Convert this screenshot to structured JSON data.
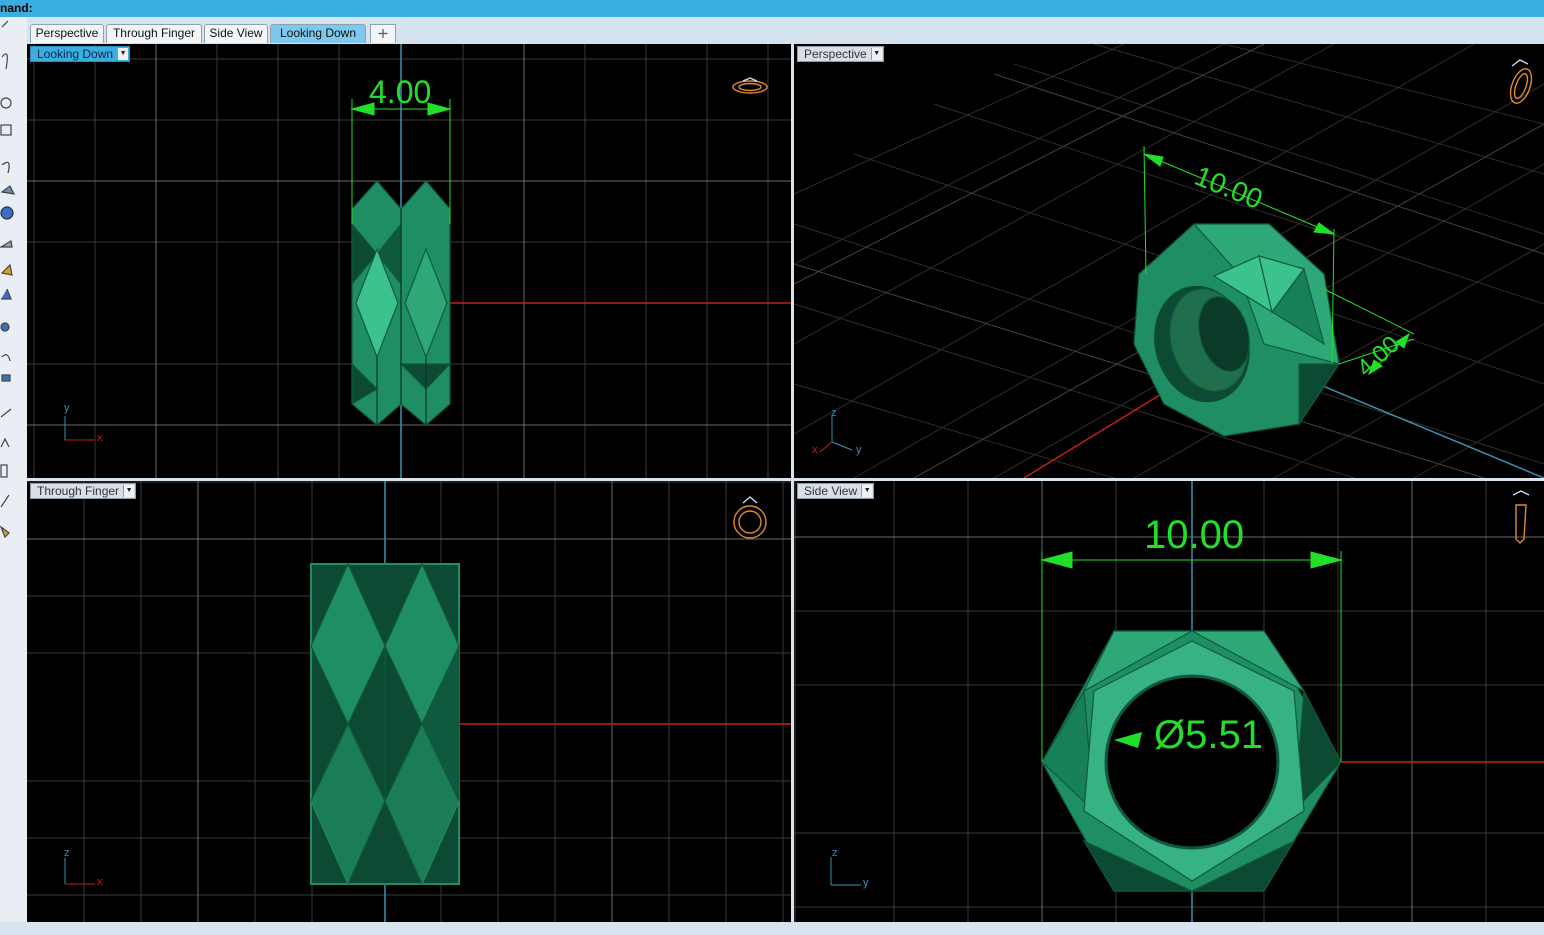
{
  "command": {
    "label": "nand:"
  },
  "tabs": [
    {
      "label": "Perspective",
      "active": false
    },
    {
      "label": "Through Finger",
      "active": false
    },
    {
      "label": "Side View",
      "active": false
    },
    {
      "label": "Looking Down",
      "active": true
    }
  ],
  "add_tab_icon": "plus-icon",
  "viewports": {
    "top_left": {
      "label": "Looking Down",
      "active": true,
      "dimension": "4.00",
      "axis_a": "y",
      "axis_b": "x"
    },
    "top_right": {
      "label": "Perspective",
      "active": false,
      "dimension_a": "10.00",
      "dimension_b": "4.00",
      "axis_a": "z",
      "axis_b": "y",
      "axis_c": "x"
    },
    "bottom_left": {
      "label": "Through Finger",
      "active": false,
      "axis_a": "z",
      "axis_b": "x"
    },
    "bottom_right": {
      "label": "Side View",
      "active": false,
      "dimension_a": "10.00",
      "dimension_b": "Ø5.51",
      "axis_a": "z",
      "axis_b": "y"
    }
  },
  "colors": {
    "ring_green": "#1f8f63",
    "ring_light": "#3cc28c",
    "ring_dark": "#0d4a33",
    "dimension_green": "#22e02a",
    "grid": "#3a3a3a",
    "x_axis": "#c0201e",
    "y_axis": "#3d8fb2",
    "active_label": "#3aaee0"
  }
}
